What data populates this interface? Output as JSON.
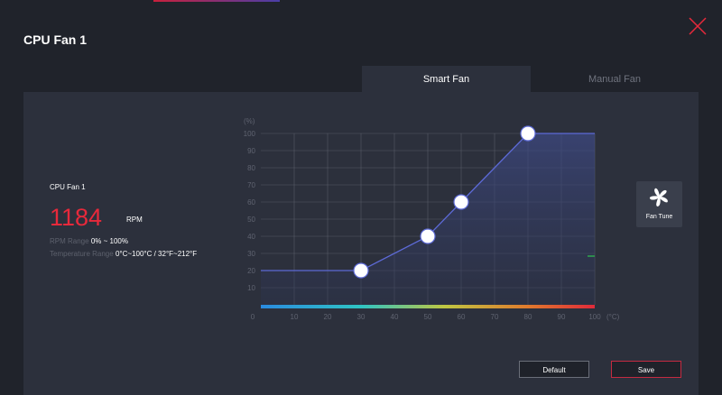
{
  "window": {
    "title": "CPU Fan 1",
    "close_icon": "close-x-icon",
    "accent_color": "#e8293b"
  },
  "tabs": [
    {
      "label": "Smart Fan",
      "active": true
    },
    {
      "label": "Manual Fan",
      "active": false
    }
  ],
  "fan_info": {
    "label": "CPU Fan 1",
    "rpm_value": "1184",
    "rpm_unit": "RPM",
    "rpm_range_label": "RPM Range",
    "rpm_range_value": "0% ~ 100%",
    "temp_range_label": "Temperature Range",
    "temp_range_value": "0°C~100°C / 32°F~212°F"
  },
  "fan_tune": {
    "label": "Fan Tune",
    "icon": "fan-icon"
  },
  "buttons": {
    "default_label": "Default",
    "save_label": "Save"
  },
  "chart_data": {
    "type": "line",
    "y_unit": "(%)",
    "x_unit": "(°C)",
    "x_ticks": [
      "0",
      "10",
      "20",
      "30",
      "40",
      "50",
      "60",
      "70",
      "80",
      "90",
      "100"
    ],
    "y_ticks": [
      "100",
      "90",
      "80",
      "70",
      "60",
      "50",
      "40",
      "30",
      "20",
      "10"
    ],
    "xlim": [
      0,
      100
    ],
    "ylim": [
      0,
      100
    ],
    "grid": true,
    "line_color": "#5d6ad6",
    "points": [
      {
        "x": 0,
        "y": 20
      },
      {
        "x": 30,
        "y": 20
      },
      {
        "x": 50,
        "y": 40
      },
      {
        "x": 60,
        "y": 60
      },
      {
        "x": 80,
        "y": 100
      },
      {
        "x": 100,
        "y": 100
      }
    ],
    "handles": [
      {
        "x": 30,
        "y": 20
      },
      {
        "x": 50,
        "y": 40
      },
      {
        "x": 60,
        "y": 60
      },
      {
        "x": 80,
        "y": 100
      }
    ]
  }
}
